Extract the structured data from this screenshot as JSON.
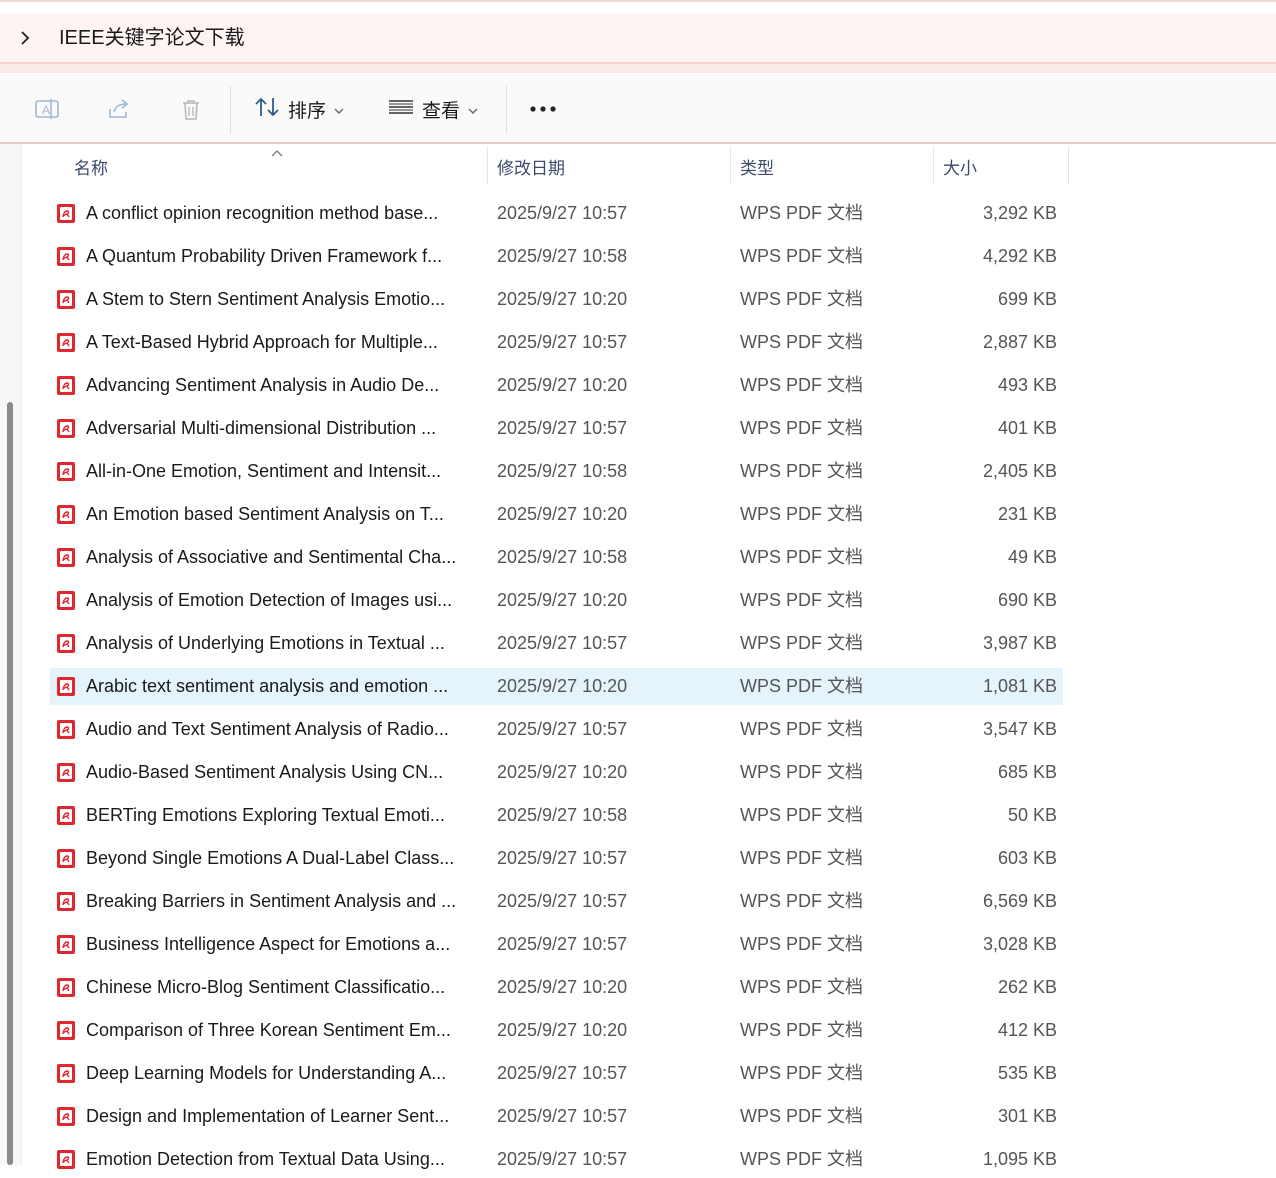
{
  "address": {
    "path_title": "IEEE关键字论文下载"
  },
  "toolbar": {
    "sort_label": "排序",
    "view_label": "查看"
  },
  "columns": {
    "name": "名称",
    "date": "修改日期",
    "type": "类型",
    "size": "大小"
  },
  "files": [
    {
      "name": "A conflict opinion recognition method base...",
      "date": "2025/9/27 10:57",
      "type": "WPS PDF 文档",
      "size": "3,292 KB"
    },
    {
      "name": "A Quantum Probability Driven Framework f...",
      "date": "2025/9/27 10:58",
      "type": "WPS PDF 文档",
      "size": "4,292 KB"
    },
    {
      "name": "A Stem to Stern Sentiment Analysis Emotio...",
      "date": "2025/9/27 10:20",
      "type": "WPS PDF 文档",
      "size": "699 KB"
    },
    {
      "name": "A Text-Based Hybrid Approach for Multiple...",
      "date": "2025/9/27 10:57",
      "type": "WPS PDF 文档",
      "size": "2,887 KB"
    },
    {
      "name": "Advancing Sentiment Analysis in Audio  De...",
      "date": "2025/9/27 10:20",
      "type": "WPS PDF 文档",
      "size": "493 KB"
    },
    {
      "name": "Adversarial Multi-dimensional Distribution ...",
      "date": "2025/9/27 10:57",
      "type": "WPS PDF 文档",
      "size": "401 KB"
    },
    {
      "name": "All-in-One  Emotion, Sentiment and Intensit...",
      "date": "2025/9/27 10:58",
      "type": "WPS PDF 文档",
      "size": "2,405 KB"
    },
    {
      "name": "An Emotion based Sentiment Analysis on T...",
      "date": "2025/9/27 10:20",
      "type": "WPS PDF 文档",
      "size": "231 KB"
    },
    {
      "name": "Analysis of Associative and Sentimental Cha...",
      "date": "2025/9/27 10:58",
      "type": "WPS PDF 文档",
      "size": "49 KB"
    },
    {
      "name": "Analysis of Emotion Detection of Images usi...",
      "date": "2025/9/27 10:20",
      "type": "WPS PDF 文档",
      "size": "690 KB"
    },
    {
      "name": "Analysis of Underlying Emotions in Textual ...",
      "date": "2025/9/27 10:57",
      "type": "WPS PDF 文档",
      "size": "3,987 KB"
    },
    {
      "name": "Arabic text sentiment analysis and emotion ...",
      "date": "2025/9/27 10:20",
      "type": "WPS PDF 文档",
      "size": "1,081 KB",
      "selected": true
    },
    {
      "name": "Audio and Text Sentiment Analysis of Radio...",
      "date": "2025/9/27 10:57",
      "type": "WPS PDF 文档",
      "size": "3,547 KB"
    },
    {
      "name": "Audio-Based Sentiment Analysis Using CN...",
      "date": "2025/9/27 10:20",
      "type": "WPS PDF 文档",
      "size": "685 KB"
    },
    {
      "name": "BERTing Emotions  Exploring Textual Emoti...",
      "date": "2025/9/27 10:58",
      "type": "WPS PDF 文档",
      "size": "50 KB"
    },
    {
      "name": "Beyond Single Emotions  A Dual-Label Class...",
      "date": "2025/9/27 10:57",
      "type": "WPS PDF 文档",
      "size": "603 KB"
    },
    {
      "name": "Breaking Barriers in Sentiment Analysis and ...",
      "date": "2025/9/27 10:57",
      "type": "WPS PDF 文档",
      "size": "6,569 KB"
    },
    {
      "name": "Business Intelligence Aspect for Emotions a...",
      "date": "2025/9/27 10:57",
      "type": "WPS PDF 文档",
      "size": "3,028 KB"
    },
    {
      "name": "Chinese Micro-Blog Sentiment Classificatio...",
      "date": "2025/9/27 10:20",
      "type": "WPS PDF 文档",
      "size": "262 KB"
    },
    {
      "name": "Comparison of Three Korean Sentiment Em...",
      "date": "2025/9/27 10:20",
      "type": "WPS PDF 文档",
      "size": "412 KB"
    },
    {
      "name": "Deep Learning Models for Understanding A...",
      "date": "2025/9/27 10:57",
      "type": "WPS PDF 文档",
      "size": "535 KB"
    },
    {
      "name": "Design and Implementation of Learner Sent...",
      "date": "2025/9/27 10:57",
      "type": "WPS PDF 文档",
      "size": "301 KB"
    },
    {
      "name": "Emotion Detection from Textual Data Using...",
      "date": "2025/9/27 10:57",
      "type": "WPS PDF 文档",
      "size": "1,095 KB"
    }
  ],
  "colors": {
    "selected_row": "#e5f3fb",
    "pdf_red": "#e0262f",
    "header_text": "#3c4a6b"
  },
  "icons": [
    "chevron-right-icon",
    "rename-icon",
    "share-icon",
    "delete-icon",
    "sort-icon",
    "view-list-icon",
    "more-icon",
    "pdf-file-icon",
    "sort-up-caret-icon"
  ]
}
